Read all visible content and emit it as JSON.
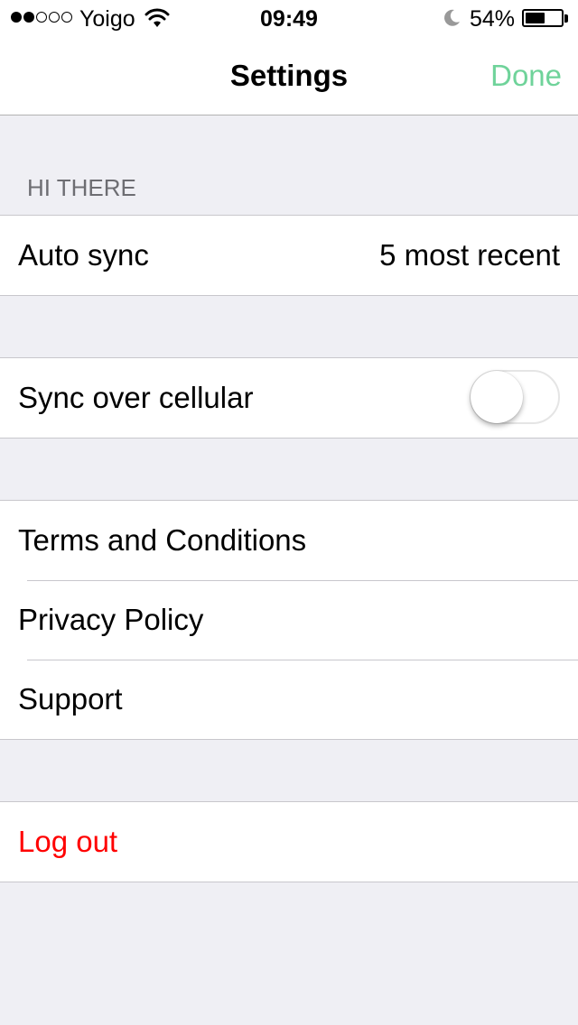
{
  "status_bar": {
    "carrier": "Yoigo",
    "time": "09:49",
    "battery_percent": "54%",
    "battery_level": 0.54,
    "signal_bars_filled": 2,
    "signal_bars_total": 5
  },
  "nav": {
    "title": "Settings",
    "done_label": "Done"
  },
  "sections": {
    "hi_there_header": "HI THERE",
    "auto_sync_label": "Auto sync",
    "auto_sync_value": "5 most recent",
    "sync_cellular_label": "Sync over cellular",
    "sync_cellular_on": false,
    "terms_label": "Terms and Conditions",
    "privacy_label": "Privacy Policy",
    "support_label": "Support",
    "logout_label": "Log out"
  },
  "colors": {
    "accent": "#6fd39a",
    "destructive": "#ff0000",
    "background": "#efeff4"
  },
  "icons": [
    "signal-dots-icon",
    "wifi-icon",
    "moon-icon",
    "battery-icon"
  ]
}
